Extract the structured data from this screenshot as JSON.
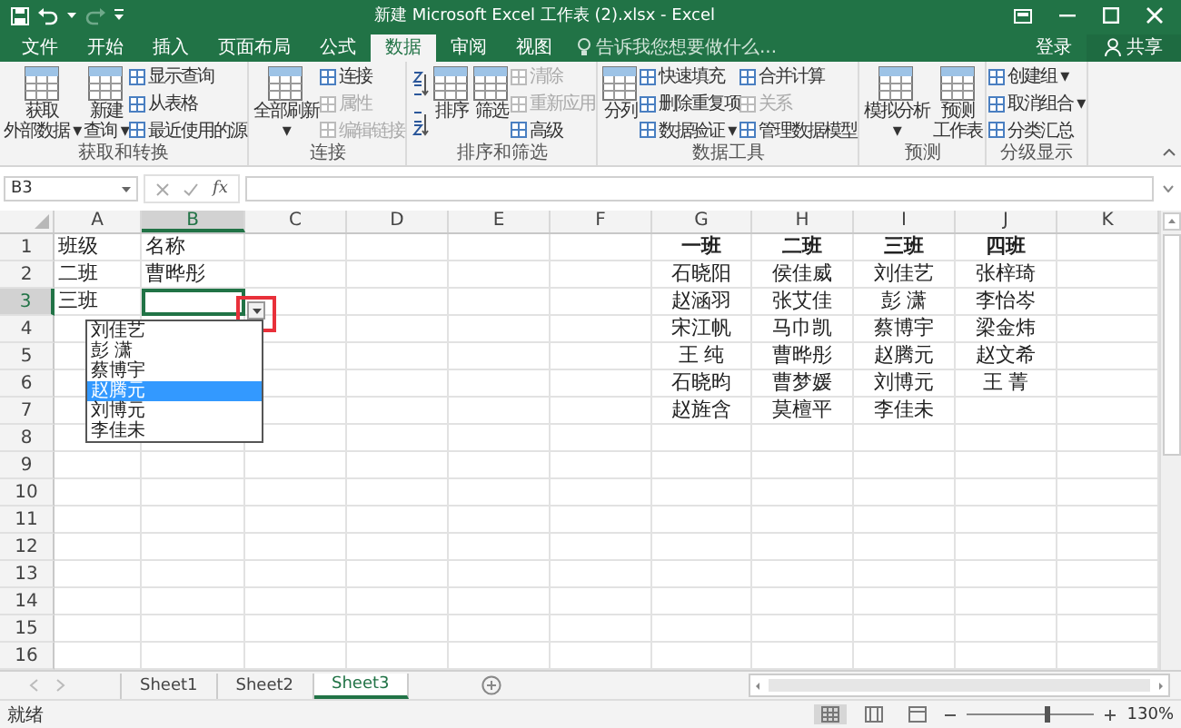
{
  "window": {
    "title": "新建 Microsoft Excel 工作表 (2).xlsx - Excel"
  },
  "tabs": [
    {
      "label": "文件",
      "selected": false
    },
    {
      "label": "开始",
      "selected": false
    },
    {
      "label": "插入",
      "selected": false
    },
    {
      "label": "页面布局",
      "selected": false
    },
    {
      "label": "公式",
      "selected": false
    },
    {
      "label": "数据",
      "selected": true
    },
    {
      "label": "审阅",
      "selected": false
    },
    {
      "label": "视图",
      "selected": false
    }
  ],
  "tell_me": {
    "placeholder": "告诉我您想要做什么..."
  },
  "account": {
    "login": "登录",
    "share": "共享"
  },
  "ribbon": {
    "groups": [
      {
        "label": "获取和转换",
        "items": [
          {
            "kind": "large",
            "lines": [
              "获取",
              "外部数据 ▾"
            ],
            "disabled": false
          },
          {
            "kind": "large",
            "lines": [
              "新建",
              "查询 ▾"
            ],
            "disabled": false
          },
          {
            "kind": "column",
            "items": [
              {
                "label": "显示查询",
                "disabled": false
              },
              {
                "label": "从表格",
                "disabled": false
              },
              {
                "label": "最近使用的源",
                "disabled": false
              }
            ]
          }
        ]
      },
      {
        "label": "连接",
        "items": [
          {
            "kind": "large",
            "lines": [
              "全部刷新",
              "▾"
            ],
            "disabled": false
          },
          {
            "kind": "column",
            "items": [
              {
                "label": "连接",
                "disabled": false
              },
              {
                "label": "属性",
                "disabled": true
              },
              {
                "label": "编辑链接",
                "disabled": true
              }
            ]
          }
        ]
      },
      {
        "label": "排序和筛选",
        "items": [
          {
            "kind": "sort"
          },
          {
            "kind": "large",
            "lines": [
              "排序"
            ],
            "disabled": false
          },
          {
            "kind": "large",
            "lines": [
              "筛选"
            ],
            "disabled": false
          },
          {
            "kind": "column",
            "items": [
              {
                "label": "清除",
                "disabled": true
              },
              {
                "label": "重新应用",
                "disabled": true
              },
              {
                "label": "高级",
                "disabled": false
              }
            ]
          }
        ]
      },
      {
        "label": "数据工具",
        "items": [
          {
            "kind": "large",
            "lines": [
              "分列"
            ],
            "disabled": false
          },
          {
            "kind": "column",
            "items": [
              {
                "label": "快速填充",
                "disabled": false
              },
              {
                "label": "删除重复项",
                "disabled": false
              },
              {
                "label": "数据验证 ▾",
                "disabled": false
              }
            ]
          },
          {
            "kind": "column",
            "items": [
              {
                "label": "合并计算",
                "disabled": false
              },
              {
                "label": "关系",
                "disabled": true
              },
              {
                "label": "管理数据模型",
                "disabled": false
              }
            ]
          }
        ]
      },
      {
        "label": "预测",
        "items": [
          {
            "kind": "large",
            "lines": [
              "模拟分析",
              "▾"
            ],
            "disabled": false
          },
          {
            "kind": "large",
            "lines": [
              "预测",
              "工作表"
            ],
            "disabled": false
          }
        ]
      },
      {
        "label": "分级显示",
        "items": [
          {
            "kind": "column",
            "items": [
              {
                "label": "创建组 ▾",
                "disabled": false
              },
              {
                "label": "取消组合 ▾",
                "disabled": false
              },
              {
                "label": "分类汇总",
                "disabled": false
              }
            ]
          }
        ]
      }
    ]
  },
  "formula_bar": {
    "name_box": "B3",
    "fx": "fx"
  },
  "columns": [
    {
      "label": "A",
      "selected": false
    },
    {
      "label": "B",
      "selected": true
    },
    {
      "label": "C",
      "selected": false
    },
    {
      "label": "D",
      "selected": false
    },
    {
      "label": "E",
      "selected": false
    },
    {
      "label": "F",
      "selected": false
    },
    {
      "label": "G",
      "selected": false
    },
    {
      "label": "H",
      "selected": false
    },
    {
      "label": "I",
      "selected": false
    },
    {
      "label": "J",
      "selected": false
    },
    {
      "label": "K",
      "selected": false
    }
  ],
  "rows": [
    {
      "label": "1",
      "selected": false
    },
    {
      "label": "2",
      "selected": false
    },
    {
      "label": "3",
      "selected": true
    },
    {
      "label": "4",
      "selected": false
    },
    {
      "label": "5",
      "selected": false
    },
    {
      "label": "6",
      "selected": false
    },
    {
      "label": "7",
      "selected": false
    },
    {
      "label": "8",
      "selected": false
    },
    {
      "label": "9",
      "selected": false
    },
    {
      "label": "10",
      "selected": false
    },
    {
      "label": "11",
      "selected": false
    },
    {
      "label": "12",
      "selected": false
    },
    {
      "label": "13",
      "selected": false
    },
    {
      "label": "14",
      "selected": false
    },
    {
      "label": "15",
      "selected": false
    },
    {
      "label": "16",
      "selected": false
    }
  ],
  "left_table": [
    [
      "班级",
      "名称"
    ],
    [
      "二班",
      "曹晔彤"
    ],
    [
      "三班"
    ]
  ],
  "class_table": [
    {
      "header": "一班",
      "names": [
        "石晓阳",
        "赵涵羽",
        "宋江帆",
        "王 纯",
        "石晓昀",
        "赵旌含"
      ]
    },
    {
      "header": "二班",
      "names": [
        "侯佳威",
        "张艾佳",
        "马巾凯",
        "曹晔彤",
        "曹梦媛",
        "莫檀平"
      ]
    },
    {
      "header": "三班",
      "names": [
        "刘佳艺",
        "彭 潇",
        "蔡博宇",
        "赵腾元",
        "刘博元",
        "李佳未"
      ]
    },
    {
      "header": "四班",
      "names": [
        "张梓琦",
        "李怡岑",
        "梁金炜",
        "赵文希",
        "王 菁"
      ]
    }
  ],
  "dropdown": {
    "items": [
      {
        "label": "刘佳艺",
        "selected": false
      },
      {
        "label": "彭 潇",
        "selected": false
      },
      {
        "label": "蔡博宇",
        "selected": false
      },
      {
        "label": "赵腾元",
        "selected": true
      },
      {
        "label": "刘博元",
        "selected": false
      },
      {
        "label": "李佳未",
        "selected": false
      }
    ]
  },
  "sheets": [
    {
      "label": "Sheet1",
      "selected": false
    },
    {
      "label": "Sheet2",
      "selected": false
    },
    {
      "label": "Sheet3",
      "selected": true
    }
  ],
  "status_bar": {
    "status": "就绪",
    "views": [
      {
        "selected": true
      },
      {
        "selected": false
      },
      {
        "selected": false
      }
    ],
    "zoom_slider": {
      "level": 0.62
    },
    "zoom": "130%"
  }
}
